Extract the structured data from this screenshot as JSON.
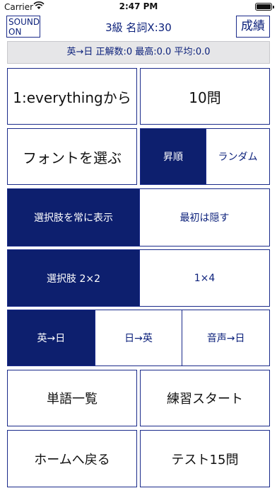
{
  "status_bar": {
    "carrier": "Carrier",
    "time": "2:47 PM"
  },
  "nav": {
    "sound_line1": "SOUND",
    "sound_line2": "ON",
    "title": "3級 名詞X:30",
    "score_label": "成績"
  },
  "stats": {
    "text": "英→日 正解数:0 最高:0.0 平均:0.0"
  },
  "buttons": {
    "start_from": "1:everythingから",
    "question_count": "10問",
    "font_select": "フォントを選ぶ",
    "word_list": "単語一覧",
    "practice_start": "練習スタート",
    "home": "ホームへ戻る",
    "test": "テスト15問"
  },
  "order_toggle": {
    "options": [
      "昇順",
      "ランダム"
    ],
    "selected": "昇順"
  },
  "choices_visibility": {
    "options": [
      "選択肢を常に表示",
      "最初は隠す"
    ],
    "selected": "選択肢を常に表示"
  },
  "choices_layout": {
    "options": [
      "選択肢 2×2",
      "1×4"
    ],
    "selected": "選択肢 2×2"
  },
  "direction": {
    "options": [
      "英→日",
      "日→英",
      "音声→日"
    ],
    "selected": "英→日"
  },
  "colors": {
    "accent": "#0d1f6e",
    "border": "#1a2a8a",
    "stats_bg": "#e6e6e8"
  }
}
